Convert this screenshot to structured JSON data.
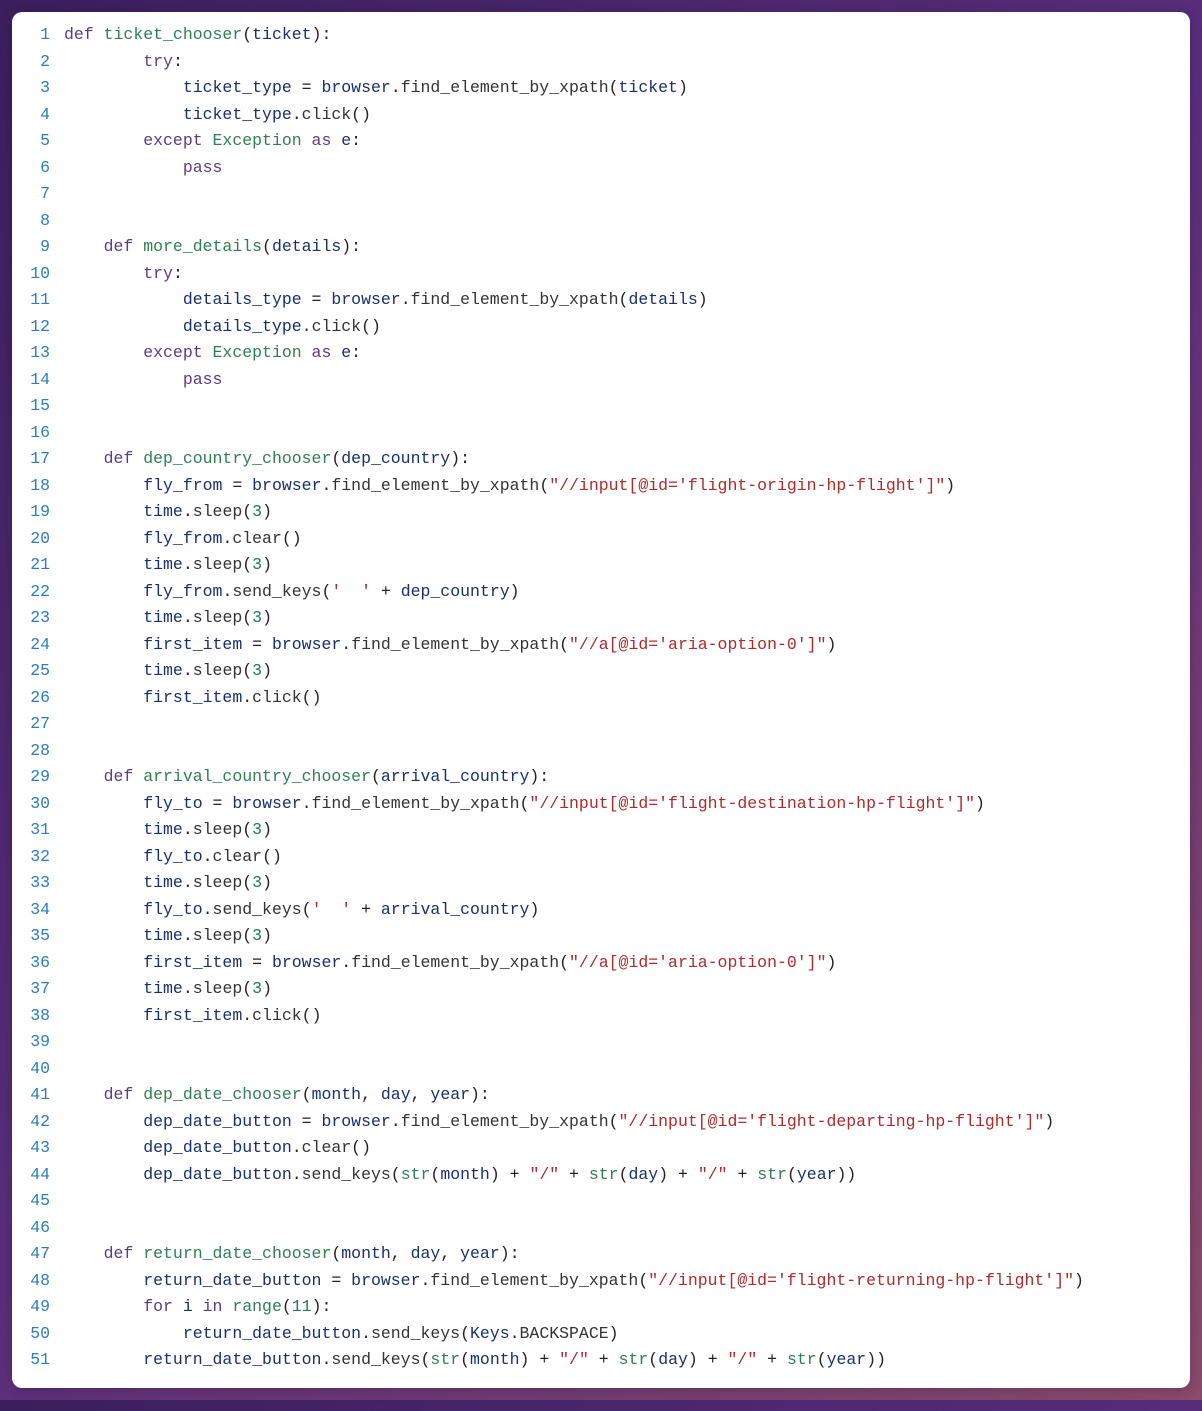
{
  "lines": [
    {
      "n": 1,
      "tokens": [
        [
          "kw",
          "def "
        ],
        [
          "fn",
          "ticket_chooser"
        ],
        [
          "punc",
          "("
        ],
        [
          "var",
          "ticket"
        ],
        [
          "punc",
          "):"
        ]
      ],
      "indent": 0
    },
    {
      "n": 2,
      "tokens": [
        [
          "kw",
          "try"
        ],
        [
          "punc",
          ":"
        ]
      ],
      "indent": 8
    },
    {
      "n": 3,
      "tokens": [
        [
          "var",
          "ticket_type"
        ],
        [
          "punc",
          " = "
        ],
        [
          "var",
          "browser"
        ],
        [
          "punc",
          "."
        ],
        [
          "attr",
          "find_element_by_xpath"
        ],
        [
          "punc",
          "("
        ],
        [
          "var",
          "ticket"
        ],
        [
          "punc",
          ")"
        ]
      ],
      "indent": 12
    },
    {
      "n": 4,
      "tokens": [
        [
          "var",
          "ticket_type"
        ],
        [
          "punc",
          "."
        ],
        [
          "attr",
          "click"
        ],
        [
          "punc",
          "()"
        ]
      ],
      "indent": 12
    },
    {
      "n": 5,
      "tokens": [
        [
          "kw",
          "except "
        ],
        [
          "fn",
          "Exception"
        ],
        [
          "kw",
          " as "
        ],
        [
          "var",
          "e"
        ],
        [
          "punc",
          ":"
        ]
      ],
      "indent": 8
    },
    {
      "n": 6,
      "tokens": [
        [
          "kw",
          "pass"
        ]
      ],
      "indent": 12
    },
    {
      "n": 7,
      "tokens": [],
      "indent": 0
    },
    {
      "n": 8,
      "tokens": [],
      "indent": 0
    },
    {
      "n": 9,
      "tokens": [
        [
          "kw",
          "def "
        ],
        [
          "fn",
          "more_details"
        ],
        [
          "punc",
          "("
        ],
        [
          "var",
          "details"
        ],
        [
          "punc",
          "):"
        ]
      ],
      "indent": 4
    },
    {
      "n": 10,
      "tokens": [
        [
          "kw",
          "try"
        ],
        [
          "punc",
          ":"
        ]
      ],
      "indent": 8
    },
    {
      "n": 11,
      "tokens": [
        [
          "var",
          "details_type"
        ],
        [
          "punc",
          " = "
        ],
        [
          "var",
          "browser"
        ],
        [
          "punc",
          "."
        ],
        [
          "attr",
          "find_element_by_xpath"
        ],
        [
          "punc",
          "("
        ],
        [
          "var",
          "details"
        ],
        [
          "punc",
          ")"
        ]
      ],
      "indent": 12
    },
    {
      "n": 12,
      "tokens": [
        [
          "var",
          "details_type"
        ],
        [
          "punc",
          "."
        ],
        [
          "attr",
          "click"
        ],
        [
          "punc",
          "()"
        ]
      ],
      "indent": 12
    },
    {
      "n": 13,
      "tokens": [
        [
          "kw",
          "except "
        ],
        [
          "fn",
          "Exception"
        ],
        [
          "kw",
          " as "
        ],
        [
          "var",
          "e"
        ],
        [
          "punc",
          ":"
        ]
      ],
      "indent": 8
    },
    {
      "n": 14,
      "tokens": [
        [
          "kw",
          "pass"
        ]
      ],
      "indent": 12
    },
    {
      "n": 15,
      "tokens": [],
      "indent": 0
    },
    {
      "n": 16,
      "tokens": [],
      "indent": 0
    },
    {
      "n": 17,
      "tokens": [
        [
          "kw",
          "def "
        ],
        [
          "fn",
          "dep_country_chooser"
        ],
        [
          "punc",
          "("
        ],
        [
          "var",
          "dep_country"
        ],
        [
          "punc",
          "):"
        ]
      ],
      "indent": 4
    },
    {
      "n": 18,
      "tokens": [
        [
          "var",
          "fly_from"
        ],
        [
          "punc",
          " = "
        ],
        [
          "var",
          "browser"
        ],
        [
          "punc",
          "."
        ],
        [
          "attr",
          "find_element_by_xpath"
        ],
        [
          "punc",
          "("
        ],
        [
          "str",
          "\"//input[@id='flight-origin-hp-flight']\""
        ],
        [
          "punc",
          ")"
        ]
      ],
      "indent": 8
    },
    {
      "n": 19,
      "tokens": [
        [
          "var",
          "time"
        ],
        [
          "punc",
          "."
        ],
        [
          "attr",
          "sleep"
        ],
        [
          "punc",
          "("
        ],
        [
          "num",
          "3"
        ],
        [
          "punc",
          ")"
        ]
      ],
      "indent": 8
    },
    {
      "n": 20,
      "tokens": [
        [
          "var",
          "fly_from"
        ],
        [
          "punc",
          "."
        ],
        [
          "attr",
          "clear"
        ],
        [
          "punc",
          "()"
        ]
      ],
      "indent": 8
    },
    {
      "n": 21,
      "tokens": [
        [
          "var",
          "time"
        ],
        [
          "punc",
          "."
        ],
        [
          "attr",
          "sleep"
        ],
        [
          "punc",
          "("
        ],
        [
          "num",
          "3"
        ],
        [
          "punc",
          ")"
        ]
      ],
      "indent": 8
    },
    {
      "n": 22,
      "tokens": [
        [
          "var",
          "fly_from"
        ],
        [
          "punc",
          "."
        ],
        [
          "attr",
          "send_keys"
        ],
        [
          "punc",
          "("
        ],
        [
          "str",
          "'  '"
        ],
        [
          "punc",
          " + "
        ],
        [
          "var",
          "dep_country"
        ],
        [
          "punc",
          ")"
        ]
      ],
      "indent": 8
    },
    {
      "n": 23,
      "tokens": [
        [
          "var",
          "time"
        ],
        [
          "punc",
          "."
        ],
        [
          "attr",
          "sleep"
        ],
        [
          "punc",
          "("
        ],
        [
          "num",
          "3"
        ],
        [
          "punc",
          ")"
        ]
      ],
      "indent": 8
    },
    {
      "n": 24,
      "tokens": [
        [
          "var",
          "first_item"
        ],
        [
          "punc",
          " = "
        ],
        [
          "var",
          "browser"
        ],
        [
          "punc",
          "."
        ],
        [
          "attr",
          "find_element_by_xpath"
        ],
        [
          "punc",
          "("
        ],
        [
          "str",
          "\"//a[@id='aria-option-0']\""
        ],
        [
          "punc",
          ")"
        ]
      ],
      "indent": 8
    },
    {
      "n": 25,
      "tokens": [
        [
          "var",
          "time"
        ],
        [
          "punc",
          "."
        ],
        [
          "attr",
          "sleep"
        ],
        [
          "punc",
          "("
        ],
        [
          "num",
          "3"
        ],
        [
          "punc",
          ")"
        ]
      ],
      "indent": 8
    },
    {
      "n": 26,
      "tokens": [
        [
          "var",
          "first_item"
        ],
        [
          "punc",
          "."
        ],
        [
          "attr",
          "click"
        ],
        [
          "punc",
          "()"
        ]
      ],
      "indent": 8
    },
    {
      "n": 27,
      "tokens": [],
      "indent": 0
    },
    {
      "n": 28,
      "tokens": [],
      "indent": 0
    },
    {
      "n": 29,
      "tokens": [
        [
          "kw",
          "def "
        ],
        [
          "fn",
          "arrival_country_chooser"
        ],
        [
          "punc",
          "("
        ],
        [
          "var",
          "arrival_country"
        ],
        [
          "punc",
          "):"
        ]
      ],
      "indent": 4
    },
    {
      "n": 30,
      "tokens": [
        [
          "var",
          "fly_to"
        ],
        [
          "punc",
          " = "
        ],
        [
          "var",
          "browser"
        ],
        [
          "punc",
          "."
        ],
        [
          "attr",
          "find_element_by_xpath"
        ],
        [
          "punc",
          "("
        ],
        [
          "str",
          "\"//input[@id='flight-destination-hp-flight']\""
        ],
        [
          "punc",
          ")"
        ]
      ],
      "indent": 8
    },
    {
      "n": 31,
      "tokens": [
        [
          "var",
          "time"
        ],
        [
          "punc",
          "."
        ],
        [
          "attr",
          "sleep"
        ],
        [
          "punc",
          "("
        ],
        [
          "num",
          "3"
        ],
        [
          "punc",
          ")"
        ]
      ],
      "indent": 8
    },
    {
      "n": 32,
      "tokens": [
        [
          "var",
          "fly_to"
        ],
        [
          "punc",
          "."
        ],
        [
          "attr",
          "clear"
        ],
        [
          "punc",
          "()"
        ]
      ],
      "indent": 8
    },
    {
      "n": 33,
      "tokens": [
        [
          "var",
          "time"
        ],
        [
          "punc",
          "."
        ],
        [
          "attr",
          "sleep"
        ],
        [
          "punc",
          "("
        ],
        [
          "num",
          "3"
        ],
        [
          "punc",
          ")"
        ]
      ],
      "indent": 8
    },
    {
      "n": 34,
      "tokens": [
        [
          "var",
          "fly_to"
        ],
        [
          "punc",
          "."
        ],
        [
          "attr",
          "send_keys"
        ],
        [
          "punc",
          "("
        ],
        [
          "str",
          "'  '"
        ],
        [
          "punc",
          " + "
        ],
        [
          "var",
          "arrival_country"
        ],
        [
          "punc",
          ")"
        ]
      ],
      "indent": 8
    },
    {
      "n": 35,
      "tokens": [
        [
          "var",
          "time"
        ],
        [
          "punc",
          "."
        ],
        [
          "attr",
          "sleep"
        ],
        [
          "punc",
          "("
        ],
        [
          "num",
          "3"
        ],
        [
          "punc",
          ")"
        ]
      ],
      "indent": 8
    },
    {
      "n": 36,
      "tokens": [
        [
          "var",
          "first_item"
        ],
        [
          "punc",
          " = "
        ],
        [
          "var",
          "browser"
        ],
        [
          "punc",
          "."
        ],
        [
          "attr",
          "find_element_by_xpath"
        ],
        [
          "punc",
          "("
        ],
        [
          "str",
          "\"//a[@id='aria-option-0']\""
        ],
        [
          "punc",
          ")"
        ]
      ],
      "indent": 8
    },
    {
      "n": 37,
      "tokens": [
        [
          "var",
          "time"
        ],
        [
          "punc",
          "."
        ],
        [
          "attr",
          "sleep"
        ],
        [
          "punc",
          "("
        ],
        [
          "num",
          "3"
        ],
        [
          "punc",
          ")"
        ]
      ],
      "indent": 8
    },
    {
      "n": 38,
      "tokens": [
        [
          "var",
          "first_item"
        ],
        [
          "punc",
          "."
        ],
        [
          "attr",
          "click"
        ],
        [
          "punc",
          "()"
        ]
      ],
      "indent": 8
    },
    {
      "n": 39,
      "tokens": [],
      "indent": 0
    },
    {
      "n": 40,
      "tokens": [],
      "indent": 0
    },
    {
      "n": 41,
      "tokens": [
        [
          "kw",
          "def "
        ],
        [
          "fn",
          "dep_date_chooser"
        ],
        [
          "punc",
          "("
        ],
        [
          "var",
          "month"
        ],
        [
          "punc",
          ", "
        ],
        [
          "var",
          "day"
        ],
        [
          "punc",
          ", "
        ],
        [
          "var",
          "year"
        ],
        [
          "punc",
          "):"
        ]
      ],
      "indent": 4
    },
    {
      "n": 42,
      "tokens": [
        [
          "var",
          "dep_date_button"
        ],
        [
          "punc",
          " = "
        ],
        [
          "var",
          "browser"
        ],
        [
          "punc",
          "."
        ],
        [
          "attr",
          "find_element_by_xpath"
        ],
        [
          "punc",
          "("
        ],
        [
          "str",
          "\"//input[@id='flight-departing-hp-flight']\""
        ],
        [
          "punc",
          ")"
        ]
      ],
      "indent": 8
    },
    {
      "n": 43,
      "tokens": [
        [
          "var",
          "dep_date_button"
        ],
        [
          "punc",
          "."
        ],
        [
          "attr",
          "clear"
        ],
        [
          "punc",
          "()"
        ]
      ],
      "indent": 8
    },
    {
      "n": 44,
      "tokens": [
        [
          "var",
          "dep_date_button"
        ],
        [
          "punc",
          "."
        ],
        [
          "attr",
          "send_keys"
        ],
        [
          "punc",
          "("
        ],
        [
          "fn",
          "str"
        ],
        [
          "punc",
          "("
        ],
        [
          "var",
          "month"
        ],
        [
          "punc",
          ") + "
        ],
        [
          "str",
          "\"/\""
        ],
        [
          "punc",
          " + "
        ],
        [
          "fn",
          "str"
        ],
        [
          "punc",
          "("
        ],
        [
          "var",
          "day"
        ],
        [
          "punc",
          ") + "
        ],
        [
          "str",
          "\"/\""
        ],
        [
          "punc",
          " + "
        ],
        [
          "fn",
          "str"
        ],
        [
          "punc",
          "("
        ],
        [
          "var",
          "year"
        ],
        [
          "punc",
          "))"
        ]
      ],
      "indent": 8
    },
    {
      "n": 45,
      "tokens": [],
      "indent": 0
    },
    {
      "n": 46,
      "tokens": [],
      "indent": 0
    },
    {
      "n": 47,
      "tokens": [
        [
          "kw",
          "def "
        ],
        [
          "fn",
          "return_date_chooser"
        ],
        [
          "punc",
          "("
        ],
        [
          "var",
          "month"
        ],
        [
          "punc",
          ", "
        ],
        [
          "var",
          "day"
        ],
        [
          "punc",
          ", "
        ],
        [
          "var",
          "year"
        ],
        [
          "punc",
          "):"
        ]
      ],
      "indent": 4
    },
    {
      "n": 48,
      "tokens": [
        [
          "var",
          "return_date_button"
        ],
        [
          "punc",
          " = "
        ],
        [
          "var",
          "browser"
        ],
        [
          "punc",
          "."
        ],
        [
          "attr",
          "find_element_by_xpath"
        ],
        [
          "punc",
          "("
        ],
        [
          "str",
          "\"//input[@id='flight-returning-hp-flight']\""
        ],
        [
          "punc",
          ")"
        ]
      ],
      "indent": 8
    },
    {
      "n": 49,
      "tokens": [
        [
          "kw",
          "for "
        ],
        [
          "var",
          "i"
        ],
        [
          "kw",
          " in "
        ],
        [
          "fn",
          "range"
        ],
        [
          "punc",
          "("
        ],
        [
          "num",
          "11"
        ],
        [
          "punc",
          "):"
        ]
      ],
      "indent": 8
    },
    {
      "n": 50,
      "tokens": [
        [
          "var",
          "return_date_button"
        ],
        [
          "punc",
          "."
        ],
        [
          "attr",
          "send_keys"
        ],
        [
          "punc",
          "("
        ],
        [
          "var",
          "Keys"
        ],
        [
          "punc",
          "."
        ],
        [
          "attr",
          "BACKSPACE"
        ],
        [
          "punc",
          ")"
        ]
      ],
      "indent": 12
    },
    {
      "n": 51,
      "tokens": [
        [
          "var",
          "return_date_button"
        ],
        [
          "punc",
          "."
        ],
        [
          "attr",
          "send_keys"
        ],
        [
          "punc",
          "("
        ],
        [
          "fn",
          "str"
        ],
        [
          "punc",
          "("
        ],
        [
          "var",
          "month"
        ],
        [
          "punc",
          ") + "
        ],
        [
          "str",
          "\"/\""
        ],
        [
          "punc",
          " + "
        ],
        [
          "fn",
          "str"
        ],
        [
          "punc",
          "("
        ],
        [
          "var",
          "day"
        ],
        [
          "punc",
          ") + "
        ],
        [
          "str",
          "\"/\""
        ],
        [
          "punc",
          " + "
        ],
        [
          "fn",
          "str"
        ],
        [
          "punc",
          "("
        ],
        [
          "var",
          "year"
        ],
        [
          "punc",
          "))"
        ]
      ],
      "indent": 8
    }
  ]
}
